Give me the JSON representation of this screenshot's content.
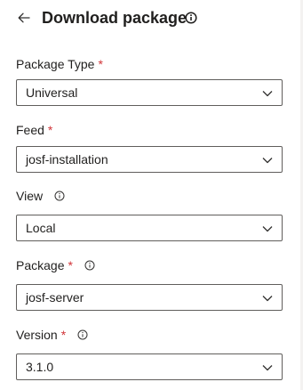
{
  "header": {
    "title": "Download package",
    "back_icon": "back-arrow-icon",
    "info_icon": "info-icon"
  },
  "fields": [
    {
      "label": "Package Type",
      "required": true,
      "info": false,
      "value": "Universal"
    },
    {
      "label": "Feed",
      "required": true,
      "info": false,
      "value": "josf-installation"
    },
    {
      "label": "View",
      "required": false,
      "info": true,
      "value": "Local"
    },
    {
      "label": "Package",
      "required": true,
      "info": true,
      "value": "josf-server"
    },
    {
      "label": "Version",
      "required": true,
      "info": true,
      "value": "3.1.0"
    }
  ],
  "required_marker": "*",
  "colors": {
    "text": "#201f1e",
    "required": "#d13438",
    "border": "#605e5c"
  }
}
